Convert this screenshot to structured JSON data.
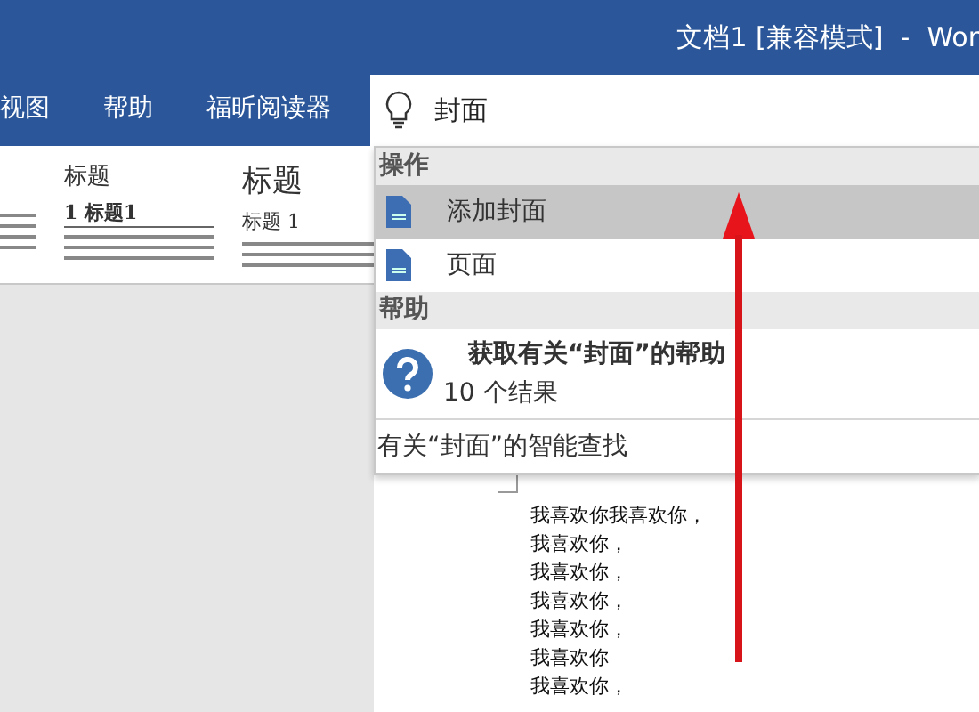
{
  "window": {
    "title": "文档1 [兼容模式]  -  Wor"
  },
  "ribbon_tabs": [
    {
      "label": "视图"
    },
    {
      "label": "帮助"
    },
    {
      "label": "福昕阅读器"
    }
  ],
  "search": {
    "value": "封面"
  },
  "style_gallery": [
    {
      "kind": "numbered",
      "heading": "标题",
      "subheading": "1 标题1"
    },
    {
      "kind": "plain",
      "heading": "标题",
      "subheading": "标题 1"
    }
  ],
  "dropdown": {
    "sections": [
      {
        "header": "操作",
        "items": [
          {
            "kind": "command",
            "label": "添加封面",
            "selected": true
          },
          {
            "kind": "command",
            "label": "页面",
            "selected": false
          }
        ]
      },
      {
        "header": "帮助",
        "items": [
          {
            "kind": "help",
            "label": "获取有关“封面”的帮助",
            "subtitle": "10 个结果",
            "selected": false
          }
        ]
      }
    ],
    "footer": "有关“封面”的智能查找"
  },
  "document": {
    "lines": [
      "我喜欢你我喜欢你，",
      "我喜欢你，",
      "我喜欢你，",
      "我喜欢你，",
      "我喜欢你，",
      "我喜欢你",
      "我喜欢你，"
    ]
  }
}
